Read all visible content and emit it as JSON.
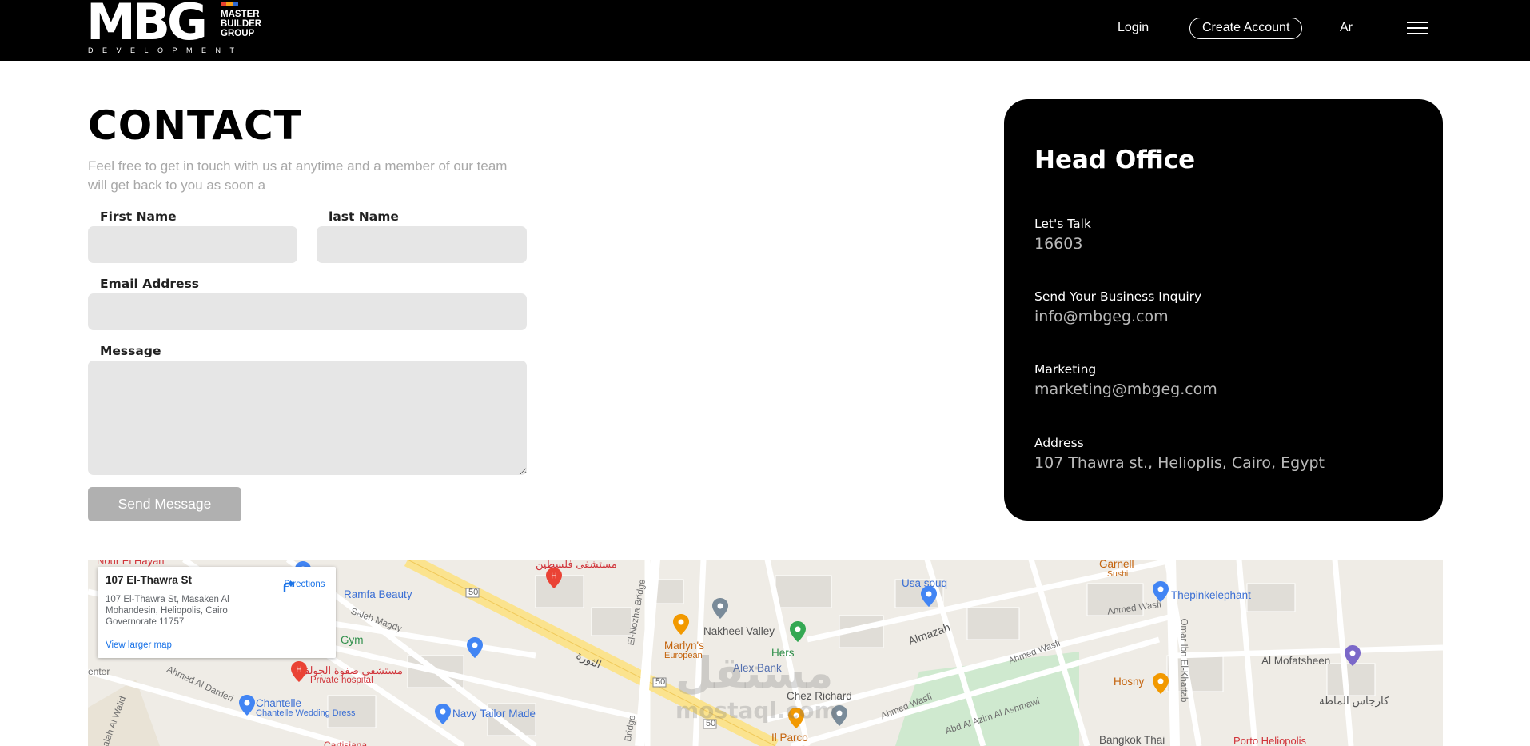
{
  "header": {
    "logo": {
      "letters": "MBG",
      "line1": "MASTER",
      "line2": "BUILDER",
      "line3": "GROUP",
      "tagline": "DEVELOPMENT",
      "stripe_colors": [
        "#e9422e",
        "#f7a11a",
        "#2e6ad3"
      ]
    },
    "login": "Login",
    "create_account": "Create Account",
    "language": "Ar",
    "menu_icon": "hamburger-icon"
  },
  "contact": {
    "title": "CONTACT",
    "subtitle": "Feel free to get in touch with us at anytime and a member of our team will get back to you as soon a",
    "first_name_label": "First Name",
    "first_name_value": "",
    "last_name_label": "last Name",
    "last_name_value": "",
    "email_label": "Email Address",
    "email_value": "",
    "message_label": "Message",
    "message_value": "",
    "send_button": "Send Message"
  },
  "office": {
    "title": "Head Office",
    "items": [
      {
        "label": "Let's Talk",
        "value": "16603"
      },
      {
        "label": "Send Your Business Inquiry",
        "value": "info@mbgeg.com"
      },
      {
        "label": "Marketing",
        "value": "marketing@mbgeg.com"
      },
      {
        "label": "Address",
        "value": "107 Thawra st., Helioplis, Cairo, Egypt"
      }
    ]
  },
  "map": {
    "card": {
      "title": "107 El-Thawra St",
      "address": "107 El-Thawra St, Masaken Al Mohandesin, Heliopolis, Cairo Governorate 11757",
      "directions": "Directions",
      "view_larger": "View larger map"
    },
    "places": {
      "nour": "Nour El Hayan",
      "falastin": "مستشفى فلسطين",
      "ramfa": "Ramfa Beauty",
      "gym": "Gym",
      "saleh": "Saleh Magdy",
      "ahmed_darderi": "Ahmed Al Darderi",
      "safwa": "مستشفى صفوة الجولف",
      "private_hospital": "Private hospital",
      "chantelle": "Chantelle",
      "chantelle_wedding": "Chantelle Wedding Dress",
      "navy": "Navy Tailor Made",
      "thawra_ar": "الثورة",
      "nozha_bridge": "El-Nozha Bridge",
      "marlyns": "Marlyn's",
      "european": "European",
      "nakheel": "Nakheel Valley",
      "hers": "Hers",
      "alex_bank": "Alex Bank",
      "chez": "Chez Richard",
      "il_parco": "Il Parco",
      "usa_souq": "Usa souq",
      "almazah": "Almazah",
      "garnell": "Garnell",
      "sushi": "Sushi",
      "thepinkelephant": "Thepinkelephant",
      "ahmed_wasfi": "Ahmed Wasfi",
      "omar": "Omar Ibn El-Khattab",
      "hosny": "Hosny",
      "mofatsheen": "Al Mofatsheen",
      "karhas": "كارجاس الماظة",
      "bangkok": "Bangkok Thai",
      "porto": "Porto Heliopolis",
      "abd_azim": "Abd Al Azim Al Ashmawi",
      "road_50": "50",
      "enter": "enter",
      "bridge": "Bridge",
      "cartisiana": "Cartisiana",
      "salah": "Salah Al Walid"
    },
    "watermark": "مستقل",
    "watermark_sub": "mostaql.com"
  }
}
